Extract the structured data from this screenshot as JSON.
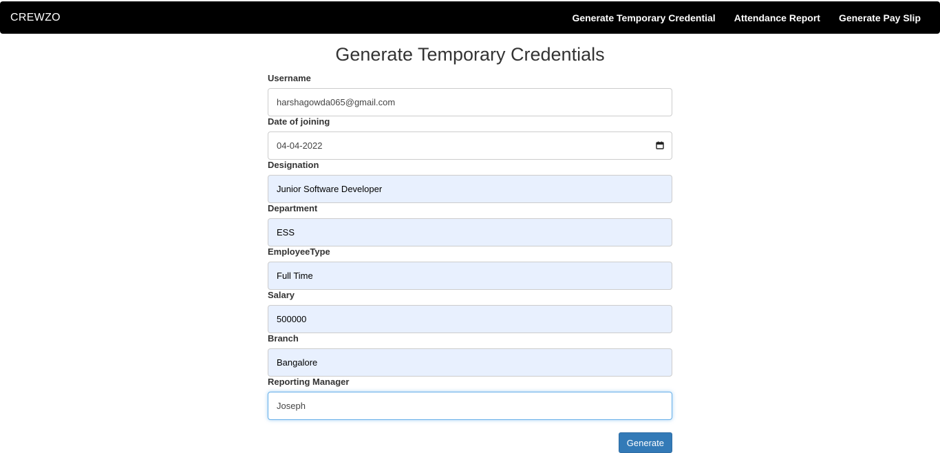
{
  "navbar": {
    "brand": "CREWZO",
    "links": [
      {
        "label": "Generate Temporary Credential"
      },
      {
        "label": "Attendance Report"
      },
      {
        "label": "Generate Pay Slip"
      }
    ]
  },
  "page": {
    "title": "Generate Temporary Credentials"
  },
  "form": {
    "fields": [
      {
        "label": "Username",
        "value": "harshagowda065@gmail.com"
      },
      {
        "label": "Date of joining",
        "value": "04-04-2022",
        "icon": "calendar-icon"
      },
      {
        "label": "Designation",
        "value": "Junior Software Developer"
      },
      {
        "label": "Department",
        "value": "ESS"
      },
      {
        "label": "EmployeeType",
        "value": "Full Time"
      },
      {
        "label": "Salary",
        "value": "500000"
      },
      {
        "label": "Branch",
        "value": "Bangalore"
      },
      {
        "label": "Reporting Manager",
        "value": "Joseph"
      }
    ],
    "submit_label": "Generate"
  },
  "colors": {
    "navbar_bg": "#000000",
    "autofill_bg": "#e8f0fe",
    "focus_border": "#66afe9",
    "button_bg": "#337ab7"
  }
}
